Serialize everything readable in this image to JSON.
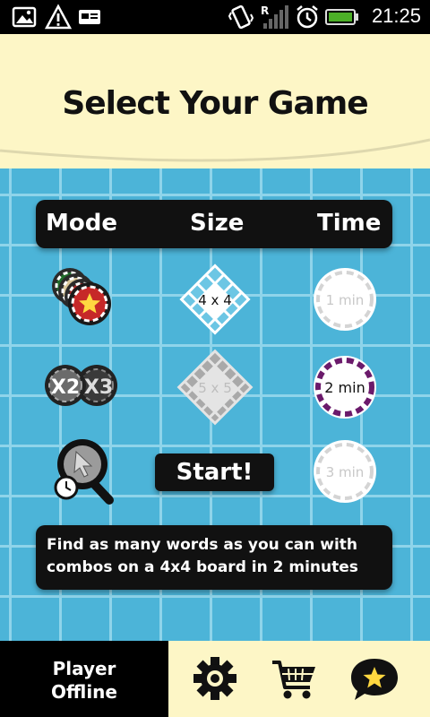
{
  "status_bar": {
    "time": "21:25",
    "icons": [
      "gallery-icon",
      "warning-icon",
      "email-icon",
      "vibrate-icon",
      "roaming-signal-icon",
      "alarm-icon",
      "battery-icon"
    ]
  },
  "header": {
    "title": "Select Your Game"
  },
  "columns": {
    "mode": "Mode",
    "size": "Size",
    "time": "Time"
  },
  "mode_options": [
    {
      "name": "classic-mode",
      "icon": "star-chips-icon"
    },
    {
      "name": "multiplier-mode",
      "labels": [
        "X2",
        "X3"
      ]
    },
    {
      "name": "search-timer-mode",
      "icon": "magnifier-clock-icon"
    }
  ],
  "size_options": [
    {
      "label": "4 x 4",
      "selected": true
    },
    {
      "label": "5 x 5",
      "selected": false
    }
  ],
  "time_options": [
    {
      "label": "1 min",
      "selected": false
    },
    {
      "label": "2 min",
      "selected": true
    },
    {
      "label": "3 min",
      "selected": false
    }
  ],
  "start_label": "Start!",
  "description": "Find as many words as you can with combos on a 4x4 board in 2 minutes",
  "bottom_bar": {
    "player_line1": "Player",
    "player_line2": "Offline",
    "buttons": [
      "settings-gear-icon",
      "shop-cart-icon",
      "favorites-star-bubble-icon"
    ]
  },
  "colors": {
    "header_bg": "#fdf6c6",
    "grid_bg": "#4cb4d8",
    "grid_lines": "#8fd4ea",
    "panel_bg": "#111111",
    "selected_time_ring": "#6b1a6b",
    "star_chip_red": "#c62828"
  }
}
